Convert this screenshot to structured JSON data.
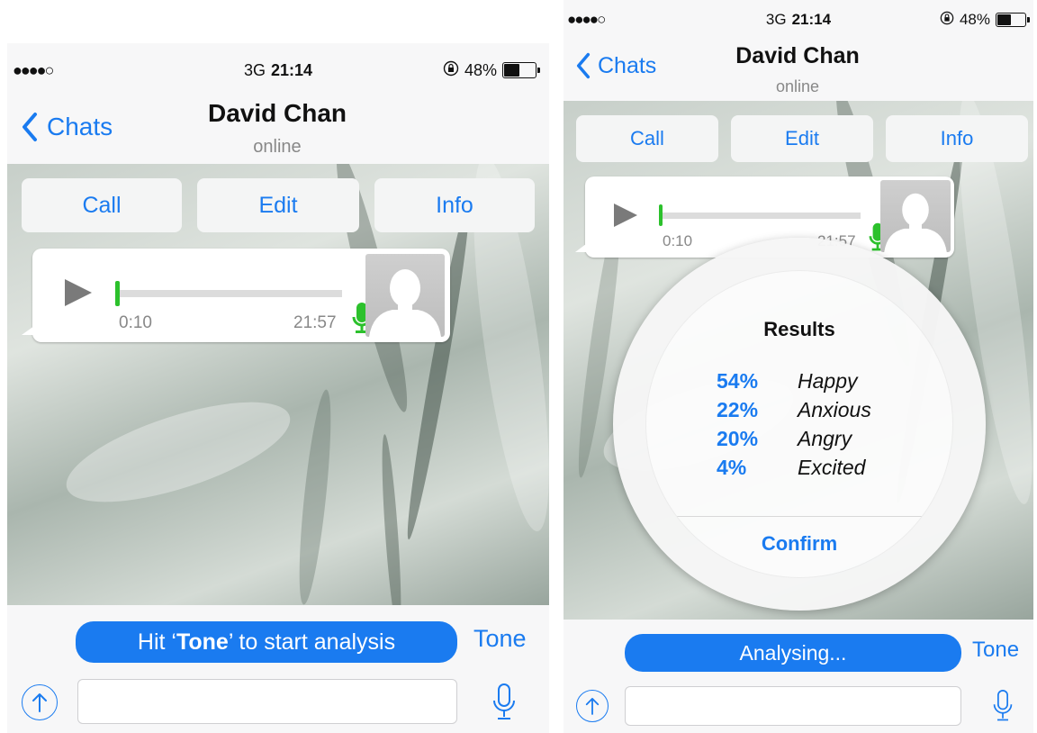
{
  "status_bar": {
    "signal": "●●●●○",
    "network": "3G",
    "time": "21:14",
    "battery": "48%",
    "battery_level": 0.48
  },
  "nav": {
    "back_label": "Chats",
    "title": "David Chan",
    "subtitle": "online"
  },
  "actions": {
    "call": "Call",
    "edit": "Edit",
    "info": "Info"
  },
  "voice_message": {
    "duration": "0:10",
    "timestamp": "21:57",
    "progress": 0.0
  },
  "left_screen": {
    "banner": {
      "prefix": "Hit ‘",
      "bold": "Tone",
      "suffix": "’ to start analysis"
    },
    "tone_label": "Tone"
  },
  "right_screen": {
    "banner": "Analysing...",
    "tone_label": "Tone",
    "results": {
      "title": "Results",
      "rows": [
        {
          "pct": "54%",
          "emotion": "Happy"
        },
        {
          "pct": "22%",
          "emotion": "Anxious"
        },
        {
          "pct": "20%",
          "emotion": "Angry"
        },
        {
          "pct": "4%",
          "emotion": "Excited"
        }
      ],
      "confirm": "Confirm"
    }
  },
  "colors": {
    "accent": "#1a7bf0",
    "mic_green": "#2cc12c"
  }
}
